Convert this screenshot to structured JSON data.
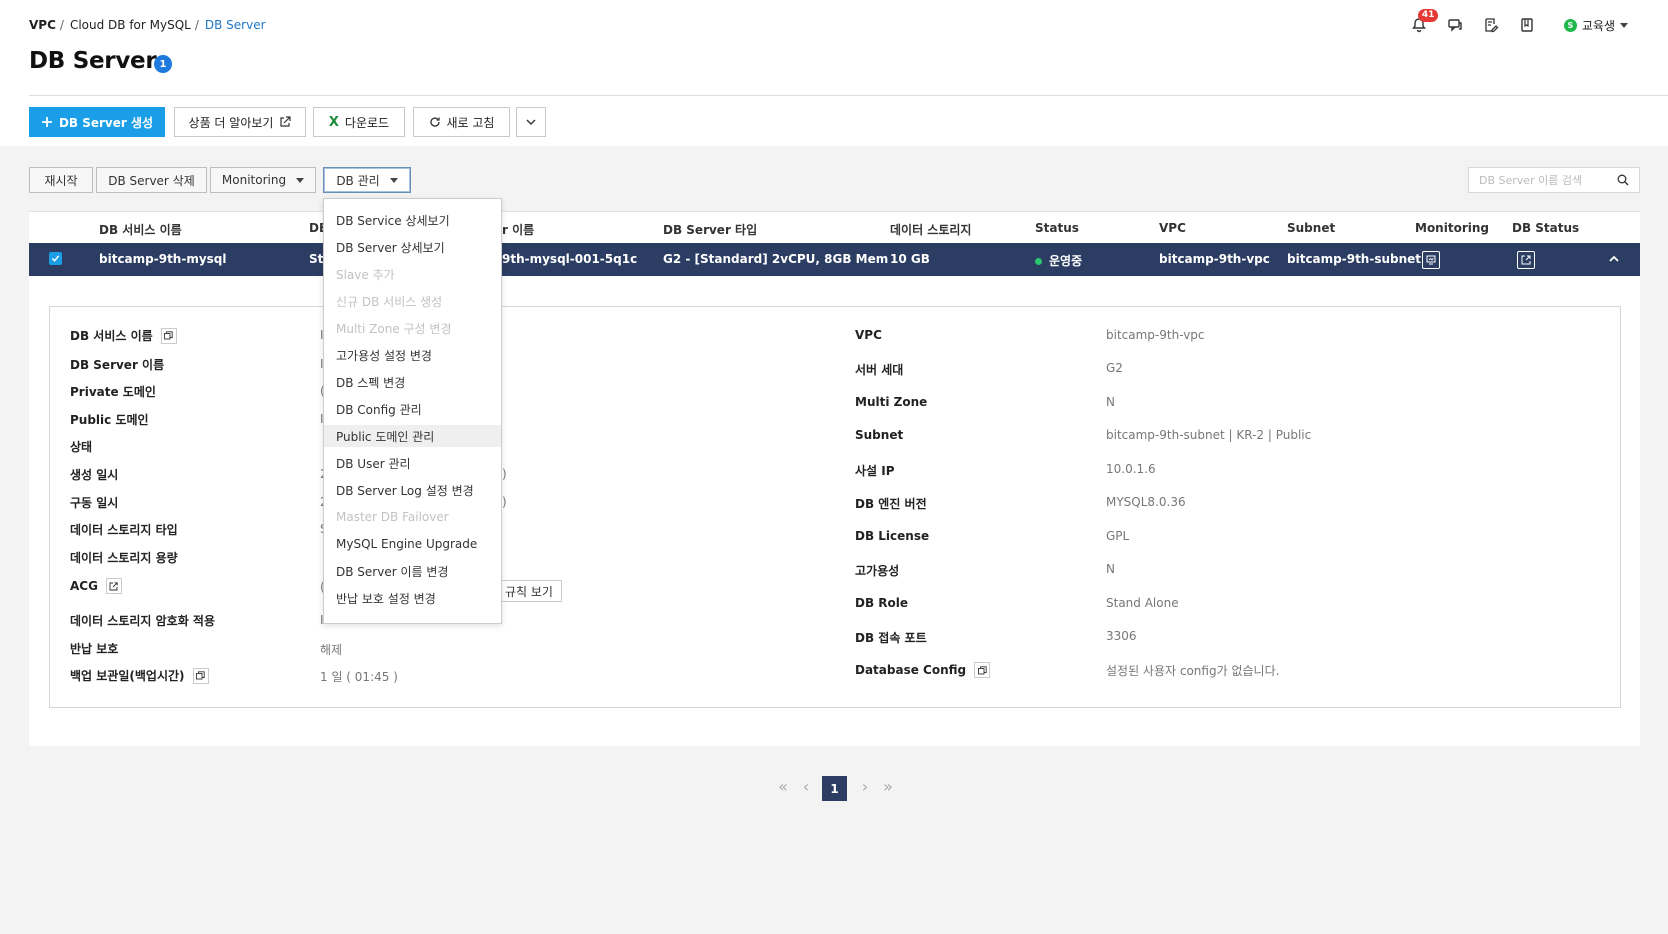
{
  "breadcrumb": {
    "vpc": "VPC",
    "sep1": "/",
    "product": "Cloud DB for MySQL",
    "sep2": "/",
    "current": "DB Server"
  },
  "title": "DB Server",
  "title_count": "1",
  "top_icons": {
    "notification_count": "41",
    "user_initial": "S",
    "user_name": "교육생"
  },
  "toolbar": {
    "create": "DB Server 생성",
    "learn_more": "상품 더 알아보기",
    "download": "다운로드",
    "refresh": "새로 고침"
  },
  "actions": {
    "restart": "재시작",
    "delete": "DB Server 삭제",
    "monitoring": "Monitoring",
    "db_manage": "DB 관리"
  },
  "search": {
    "placeholder": "DB Server 이름 검색"
  },
  "table": {
    "headers": [
      "DB 서비스 이름",
      "DB",
      "r 이름",
      "DB Server 타입",
      "데이터 스토리지",
      "Status",
      "VPC",
      "Subnet",
      "Monitoring",
      "DB Status"
    ],
    "row": {
      "service_name": "bitcamp-9th-mysql",
      "role_partial": "Sta",
      "server_name_partial": "9th-mysql-001-5q1c",
      "server_type": "G2 - [Standard] 2vCPU, 8GB Mem",
      "storage": "10 GB",
      "status": "운영중",
      "vpc": "bitcamp-9th-vpc",
      "subnet": "bitcamp-9th-subnet"
    }
  },
  "detail": {
    "left_labels": [
      "DB 서비스 이름",
      "DB Server 이름",
      "Private 도메인",
      "Public 도메인",
      "상태",
      "생성 일시",
      "구동 일시",
      "데이터 스토리지 타입",
      "데이터 스토리지 용량",
      "ACG",
      "데이터 스토리지 암호화 적용",
      "반납 보호",
      "백업 보관일(백업시간)"
    ],
    "left_partials": [
      "I",
      "I",
      "(",
      "I",
      "",
      "2",
      "2",
      "S",
      "",
      "(",
      "I"
    ],
    "paren_1": ")",
    "paren_2": ")",
    "acg_rule": "규칙 보기",
    "return_protect": "해제",
    "backup": "1 일 ( 01:45 )",
    "right_labels": [
      "VPC",
      "서버 세대",
      "Multi Zone",
      "Subnet",
      "사설 IP",
      "DB 엔진 버전",
      "DB License",
      "고가용성",
      "DB Role",
      "DB 접속 포트",
      "Database Config"
    ],
    "right_values": [
      "bitcamp-9th-vpc",
      "G2",
      "N",
      "bitcamp-9th-subnet | KR-2 | Public",
      "10.0.1.6",
      "MYSQL8.0.36",
      "GPL",
      "N",
      "Stand Alone",
      "3306",
      "설정된 사용자 config가 없습니다."
    ]
  },
  "dropdown": [
    {
      "label": "DB Service 상세보기",
      "disabled": false
    },
    {
      "label": "DB Server 상세보기",
      "disabled": false
    },
    {
      "label": "Slave 추가",
      "disabled": true
    },
    {
      "label": "신규 DB 서비스 생성",
      "disabled": true
    },
    {
      "label": "Multi Zone 구성 변경",
      "disabled": true
    },
    {
      "label": "고가용성 설정 변경",
      "disabled": false
    },
    {
      "label": "DB 스펙 변경",
      "disabled": false
    },
    {
      "label": "DB Config 관리",
      "disabled": false
    },
    {
      "label": "Public 도메인 관리",
      "disabled": false,
      "hover": true
    },
    {
      "label": "DB User 관리",
      "disabled": false
    },
    {
      "label": "DB Server Log 설정 변경",
      "disabled": false
    },
    {
      "label": "Master DB Failover",
      "disabled": true
    },
    {
      "label": "MySQL Engine Upgrade",
      "disabled": false
    },
    {
      "label": "DB Server 이름 변경",
      "disabled": false
    },
    {
      "label": "반납 보호 설정 변경",
      "disabled": false
    }
  ],
  "pagination": {
    "first": "«",
    "prev": "‹",
    "current": "1",
    "next": "›",
    "last": "»"
  },
  "colors": {
    "primary": "#1b9ee8",
    "row_selected": "#2c3d63",
    "status_green": "#28c76f",
    "badge_red": "#e53935"
  }
}
